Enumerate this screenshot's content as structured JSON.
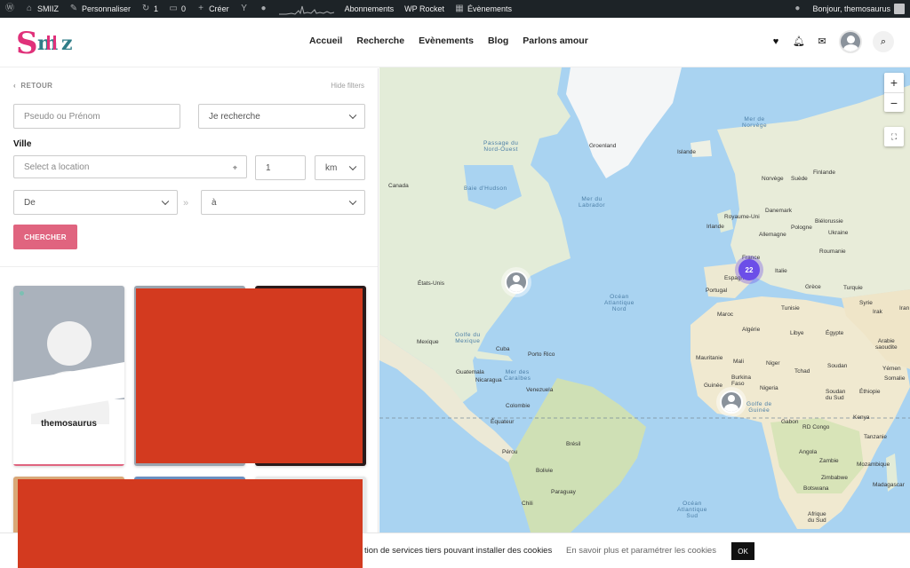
{
  "admin_bar": {
    "site_name": "SMIIZ",
    "customize": "Personnaliser",
    "updates_count": "1",
    "comments_count": "0",
    "new_label": "Créer",
    "subscriptions": "Abonnements",
    "wp_rocket": "WP Rocket",
    "events": "Évènements",
    "greeting": "Bonjour, themosaurus"
  },
  "header": {
    "logo_text": "SMIIZ",
    "nav": [
      "Accueil",
      "Recherche",
      "Evènements",
      "Blog",
      "Parlons amour"
    ]
  },
  "search_panel": {
    "back_label": "RETOUR",
    "hide_filters_label": "Hide filters",
    "pseudo_placeholder": "Pseudo ou Prénom",
    "looking_for_value": "Je recherche",
    "city_label": "Ville",
    "location_placeholder": "Select a location",
    "distance_value": "1",
    "distance_unit": "km",
    "age_from": "De",
    "age_to": "à",
    "search_button": "CHERCHER"
  },
  "profiles": [
    {
      "username": "themosaurus",
      "online": true
    }
  ],
  "map": {
    "cluster_count": "22",
    "zoom_in": "+",
    "zoom_out": "−",
    "labels": {
      "groenland": "Groenland",
      "islande": "Islande",
      "mer_norvege": "Mer de\nNorvège",
      "finlande": "Finlande",
      "norvege": "Norvège",
      "suede": "Suède",
      "mer_labrador": "Mer du\nLabrador",
      "baie_hudson": "Baie d'Hudson",
      "passage_nw": "Passage du\nNord-Ouest",
      "canada": "Canada",
      "royaume_uni": "Royaume-Uni",
      "danemark": "Danemark",
      "bielorussie": "Biélorussie",
      "irlande": "Irlande",
      "allemagne": "Allemagne",
      "pologne": "Pologne",
      "ukraine": "Ukraine",
      "roumanie": "Roumanie",
      "france": "France",
      "espagne": "Espagne",
      "italie": "Italie",
      "portugal": "Portugal",
      "grece": "Grèce",
      "turquie": "Turquie",
      "etats_unis": "États-Unis",
      "ocean_atlantique_nord": "Océan\nAtlantique\nNord",
      "maroc": "Maroc",
      "tunisie": "Tunisie",
      "syrie": "Syrie",
      "irak": "Irak",
      "iran": "Iran",
      "algerie": "Algérie",
      "libye": "Libye",
      "egypte": "Égypte",
      "arabie": "Arabie\nsaoudite",
      "mexique": "Mexique",
      "golfe_mexique": "Golfe du\nMexique",
      "cuba": "Cuba",
      "porto_rico": "Porto Rico",
      "mauritanie": "Mauritanie",
      "mali": "Mali",
      "niger": "Niger",
      "tchad": "Tchad",
      "soudan": "Soudan",
      "yemen": "Yémen",
      "mer_caraibes": "Mer des\nCaraïbes",
      "guatemala": "Guatemala",
      "nicaragua": "Nicaragua",
      "venezuela": "Venezuela",
      "guinee": "Guinée",
      "burkina": "Burkina\nFaso",
      "nigeria": "Nigeria",
      "soudan_sud": "Soudan\ndu Sud",
      "ethiopie": "Éthiopie",
      "somalie": "Somalie",
      "colombie": "Colombie",
      "golfe_guinee": "Golfe de\nGuinée",
      "equateur": "Équateur",
      "gabon": "Gabon",
      "rd_congo": "RD Congo",
      "kenya": "Kenya",
      "tanzanie": "Tanzanie",
      "perou": "Pérou",
      "bresil": "Brésil",
      "angola": "Angola",
      "zambie": "Zambie",
      "mozambique": "Mozambique",
      "bolivie": "Bolivie",
      "zimbabwe": "Zimbabwe",
      "madagascar": "Madagascar",
      "paraguay": "Paraguay",
      "botswana": "Botswana",
      "ocean_atlantique_sud": "Océan\nAtlantique\nSud",
      "chili": "Chili",
      "afrique_sud": "Afrique\ndu Sud"
    }
  },
  "cookie_bar": {
    "text": "tion de services tiers pouvant installer des cookies",
    "more_link": "En savoir plus et paramétrer les cookies",
    "ok_button": "OK"
  },
  "colors": {
    "accent": "#e0647f",
    "admin_bar": "#1d2327",
    "cluster": "#6c4ee8",
    "ocean": "#a9d3f1",
    "land": "#eef0e4",
    "redaction": "#d33a1f"
  }
}
